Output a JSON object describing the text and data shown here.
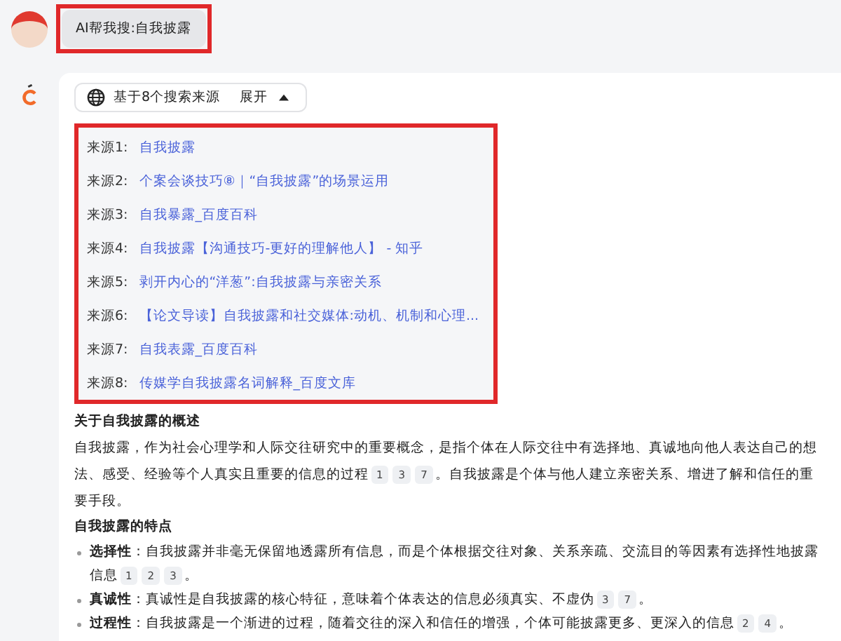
{
  "query": {
    "text": "AI帮我搜:自我披露"
  },
  "sources_toggle": {
    "summary": "基于8个搜索来源",
    "action": "展开",
    "expanded": true
  },
  "sources": [
    {
      "label": "来源1:",
      "title": "自我披露"
    },
    {
      "label": "来源2:",
      "title": "个案会谈技巧⑧｜“自我披露”的场景运用"
    },
    {
      "label": "来源3:",
      "title": "自我暴露_百度百科"
    },
    {
      "label": "来源4:",
      "title": "自我披露【沟通技巧-更好的理解他人】 - 知乎"
    },
    {
      "label": "来源5:",
      "title": "剥开内心的“洋葱”:自我披露与亲密关系"
    },
    {
      "label": "来源6:",
      "title": "【论文导读】自我披露和社交媒体:动机、机制和心理..."
    },
    {
      "label": "来源7:",
      "title": "自我表露_百度百科"
    },
    {
      "label": "来源8:",
      "title": "传媒学自我披露名词解释_百度文库"
    }
  ],
  "answer": [
    {
      "kind": "heading",
      "text": "关于自我披露的概述"
    },
    {
      "kind": "paragraph",
      "text": "自我披露，作为社会心理学和人际交往研究中的重要概念，是指个体在人际交往中有选择地、真诚地向他人表达自己的想法、感受、经验等个人真实且重要的信息的过程",
      "cites": [
        "1",
        "3",
        "7"
      ],
      "tail": "。自我披露是个体与他人建立亲密关系、增进了解和信任的重要手段。"
    },
    {
      "kind": "heading",
      "text": "自我披露的特点"
    },
    {
      "kind": "bullet",
      "text": "**选择性**：自我披露并非毫无保留地透露所有信息，而是个体根据交往对象、关系亲疏、交流目的等因素有选择性地披露信息",
      "cites": [
        "1",
        "2",
        "3"
      ],
      "tail": "。"
    },
    {
      "kind": "bullet",
      "text": "**真诚性**：真诚性是自我披露的核心特征，意味着个体表达的信息必须真实、不虚伪",
      "cites": [
        "3",
        "7"
      ],
      "tail": "。"
    },
    {
      "kind": "bullet",
      "text": "**过程性**：自我披露是一个渐进的过程，随着交往的深入和信任的增强，个体可能披露更多、更深入的信息",
      "cites": [
        "2",
        "4"
      ],
      "tail": "。"
    }
  ]
}
